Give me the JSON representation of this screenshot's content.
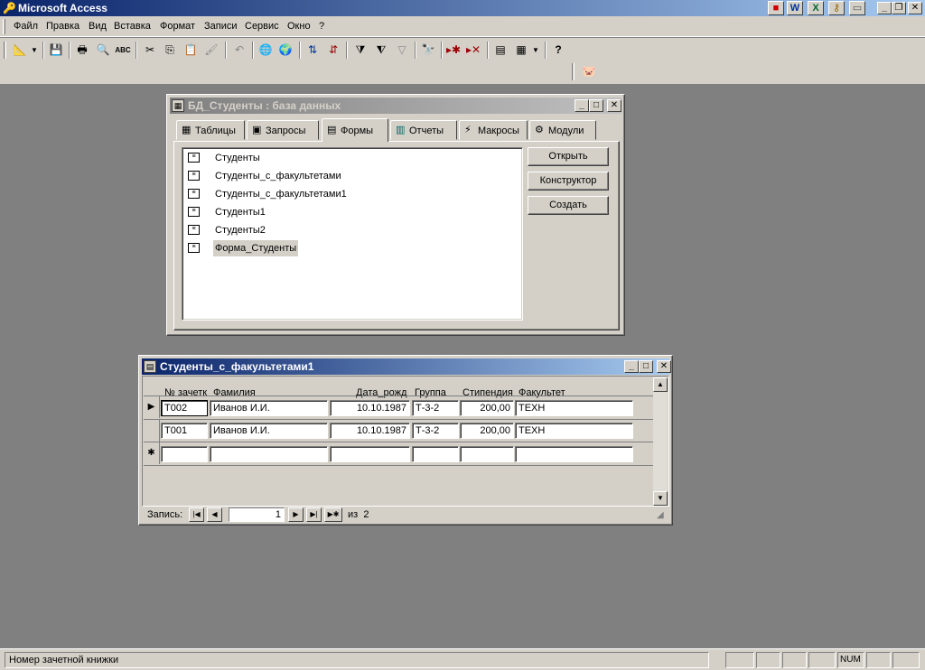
{
  "app": {
    "title": "Microsoft Access"
  },
  "menu": [
    "Файл",
    "Правка",
    "Вид",
    "Вставка",
    "Формат",
    "Записи",
    "Сервис",
    "Окно",
    "?"
  ],
  "db_window": {
    "title": "БД_Студенты : база данных",
    "tabs": [
      "Таблицы",
      "Запросы",
      "Формы",
      "Отчеты",
      "Макросы",
      "Модули"
    ],
    "active_tab": "Формы",
    "forms": [
      "Студенты",
      "Студенты_с_факультетами",
      "Студенты_с_факультетами1",
      "Студенты1",
      "Студенты2",
      "Форма_Студенты"
    ],
    "selected_form": "Форма_Студенты",
    "buttons": [
      "Открыть",
      "Конструктор",
      "Создать"
    ]
  },
  "form_window": {
    "title": "Студенты_с_факультетами1",
    "columns": [
      "№ зачетк",
      "Фамилия",
      "Дата_рожд",
      "Группа",
      "Стипендия",
      "Факультет"
    ],
    "rows": [
      [
        "Т002",
        "Иванов И.И.",
        "10.10.1987",
        "Т-3-2",
        "200,00",
        "ТЕХН"
      ],
      [
        "Т001",
        "Иванов И.И.",
        "10.10.1987",
        "Т-3-2",
        "200,00",
        "ТЕХН"
      ]
    ],
    "current_record_marker": "▶",
    "new_record_marker": "✱",
    "nav": {
      "label": "Запись:",
      "current": "1",
      "of_label": "из",
      "total": "2"
    }
  },
  "status": {
    "text": "Номер зачетной книжки",
    "num": "NUM"
  }
}
